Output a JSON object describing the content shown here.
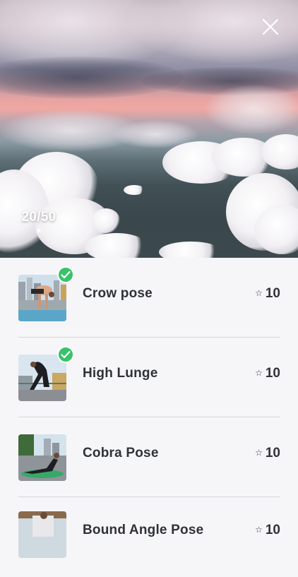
{
  "header": {
    "progress_text": "20/50",
    "progress_star": "★"
  },
  "exercises": [
    {
      "title": "Crow pose",
      "points": "10",
      "points_star": "☆",
      "completed": true
    },
    {
      "title": "High Lunge",
      "points": "10",
      "points_star": "☆",
      "completed": true
    },
    {
      "title": "Cobra Pose",
      "points": "10",
      "points_star": "☆",
      "completed": false
    },
    {
      "title": "Bound Angle Pose",
      "points": "10",
      "points_star": "☆",
      "completed": false
    }
  ],
  "colors": {
    "check_green": "#3ac26a",
    "text_dark": "#2f3237",
    "list_bg": "#f6f6f8",
    "divider": "#d5d6db"
  }
}
